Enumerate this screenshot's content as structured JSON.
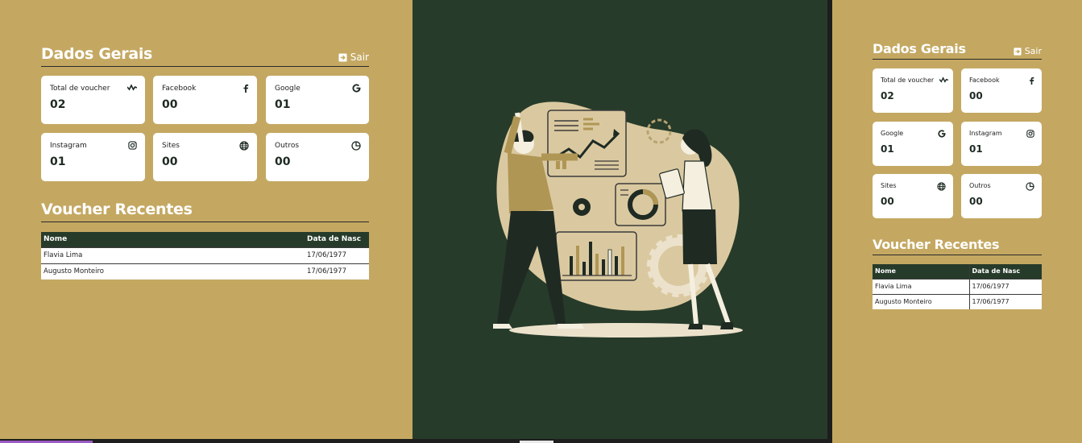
{
  "dashboard": {
    "section_title": "Dados Gerais",
    "logout_label": "Sair",
    "cards": [
      {
        "label": "Total de voucher",
        "value": "02",
        "icon": "activity-icon"
      },
      {
        "label": "Facebook",
        "value": "00",
        "icon": "facebook-icon"
      },
      {
        "label": "Google",
        "value": "01",
        "icon": "google-icon"
      },
      {
        "label": "Instagram",
        "value": "01",
        "icon": "instagram-icon"
      },
      {
        "label": "Sites",
        "value": "00",
        "icon": "globe-icon"
      },
      {
        "label": "Outros",
        "value": "00",
        "icon": "pie-chart-icon"
      }
    ],
    "recent_title": "Voucher Recentes",
    "table": {
      "headers": [
        "Nome",
        "Data de Nasc"
      ],
      "rows": [
        [
          "Flavia Lima",
          "17/06/1977"
        ],
        [
          "Augusto Monteiro",
          "17/06/1977"
        ]
      ]
    }
  },
  "colors": {
    "background": "#c4a862",
    "accent_dark": "#273b2a",
    "card": "#ffffff"
  }
}
